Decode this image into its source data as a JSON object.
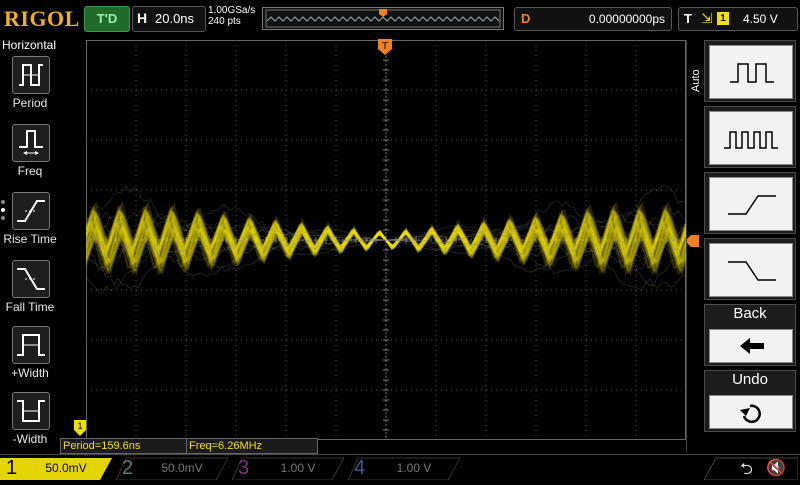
{
  "header": {
    "logo": "RIGOL",
    "run_status": "T'D",
    "horizontal_letter": "H",
    "timebase": "20.0ns",
    "sample_rate": "1.00GSa/s",
    "points": "240 pts",
    "delay_letter": "D",
    "delay_value": "0.00000000ps",
    "trigger_letter": "T",
    "trigger_source": "1",
    "trigger_level": "4.50 V"
  },
  "left_menu": {
    "title": "Horizontal",
    "items": [
      {
        "label": "Period",
        "icon": "period-icon"
      },
      {
        "label": "Freq",
        "icon": "frequency-icon"
      },
      {
        "label": "Rise Time",
        "icon": "rise-time-icon"
      },
      {
        "label": "Fall Time",
        "icon": "fall-time-icon"
      },
      {
        "label": "+Width",
        "icon": "positive-width-icon"
      },
      {
        "label": "-Width",
        "icon": "negative-width-icon"
      }
    ]
  },
  "measurements": {
    "period": "Period=159.6ns",
    "freq": "Freq=6.26MHz"
  },
  "channels": [
    {
      "num": "1",
      "scale": "50.0mV",
      "color": "#f0e000",
      "active": true
    },
    {
      "num": "2",
      "scale": "50.0mV",
      "color": "#00c8c8",
      "active": false
    },
    {
      "num": "3",
      "scale": "1.00 V",
      "color": "#d000d0",
      "active": false
    },
    {
      "num": "4",
      "scale": "1.00 V",
      "color": "#2060ff",
      "active": false
    }
  ],
  "right_menu": {
    "mode_label": "Auto",
    "back_label": "Back",
    "undo_label": "Undo",
    "icons": [
      "single-pulse-icon",
      "pulse-train-icon",
      "rising-edge-icon",
      "falling-edge-icon",
      "back-arrow-icon",
      "undo-icon"
    ]
  },
  "markers": {
    "trigger_position": "T",
    "ground_ch1": "1"
  },
  "colors": {
    "ch1": "#f0e000",
    "accent": "#f08020",
    "run_status": "#1f6b2a"
  }
}
